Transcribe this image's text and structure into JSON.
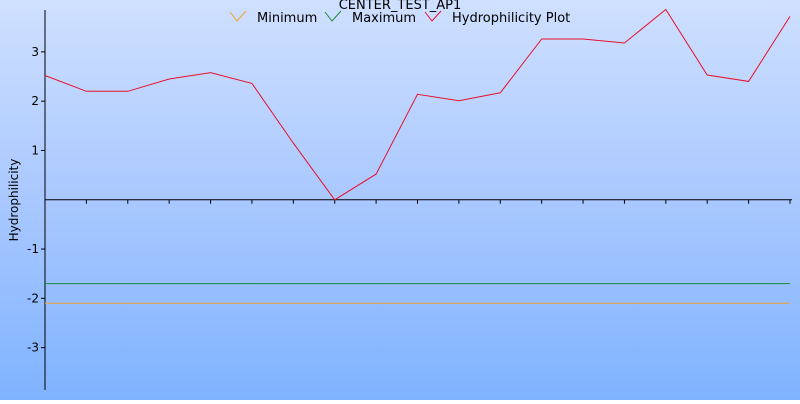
{
  "chart_data": {
    "type": "line",
    "title": "CENTER_TEST_AP1",
    "xlabel": "",
    "ylabel": "Hydrophilicity",
    "ylim": [
      -3.9,
      3.9
    ],
    "yticks": [
      3,
      2,
      1,
      -1,
      -2,
      -3
    ],
    "ytick_labels": [
      "3",
      "2",
      "1",
      "-1",
      "-2",
      "-3"
    ],
    "grid": false,
    "legend_position": "top-center",
    "x": [
      1,
      2,
      3,
      4,
      5,
      6,
      7,
      8,
      9,
      10,
      11,
      12,
      13,
      14,
      15,
      16,
      17,
      18,
      19
    ],
    "series": [
      {
        "name": "Minimum",
        "color": "#f0a030",
        "values": [
          -2.1,
          -2.1,
          -2.1,
          -2.1,
          -2.1,
          -2.1,
          -2.1,
          -2.1,
          -2.1,
          -2.1,
          -2.1,
          -2.1,
          -2.1,
          -2.1,
          -2.1,
          -2.1,
          -2.1,
          -2.1,
          -2.1
        ]
      },
      {
        "name": "Maximum",
        "color": "#1a8a3a",
        "values": [
          -1.7,
          -1.7,
          -1.7,
          -1.7,
          -1.7,
          -1.7,
          -1.7,
          -1.7,
          -1.7,
          -1.7,
          -1.7,
          -1.7,
          -1.7,
          -1.7,
          -1.7,
          -1.7,
          -1.7,
          -1.7,
          -1.7
        ]
      },
      {
        "name": "Hydrophilicity Plot",
        "color": "#e8102a",
        "values": [
          2.52,
          2.2,
          2.2,
          2.45,
          2.58,
          2.36,
          1.15,
          0.0,
          0.52,
          2.14,
          2.01,
          2.17,
          3.26,
          3.26,
          3.18,
          3.86,
          2.53,
          2.4,
          3.72
        ]
      }
    ]
  }
}
